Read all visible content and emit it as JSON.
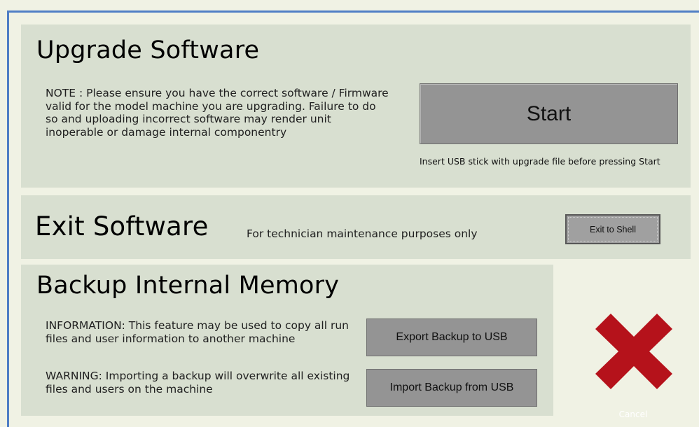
{
  "upgrade": {
    "title": "Upgrade Software",
    "note": "NOTE : Please ensure you have the correct software / Firmware valid for the model machine you are upgrading. Failure to do so and uploading incorrect software may render unit inoperable or damage internal componentry",
    "start_label": "Start",
    "usb_hint": "Insert USB stick with upgrade file before pressing Start"
  },
  "exit": {
    "title": "Exit Software",
    "note": "For technician maintenance purposes only",
    "shell_label": "Exit to Shell"
  },
  "backup": {
    "title": "Backup Internal Memory",
    "information": "INFORMATION: This feature may be used to copy all run files and user information to another machine",
    "warning": "WARNING: Importing a backup will overwrite all existing files and users on the machine",
    "export_label": "Export Backup to USB",
    "import_label": "Import Backup from USB"
  },
  "cancel": {
    "label": "Cancel",
    "icon": "red-x-icon",
    "icon_color": "#b5121b"
  },
  "colors": {
    "window_border": "#4f7ec5",
    "panel_background": "#d8dfd0",
    "button_background": "#949494"
  }
}
